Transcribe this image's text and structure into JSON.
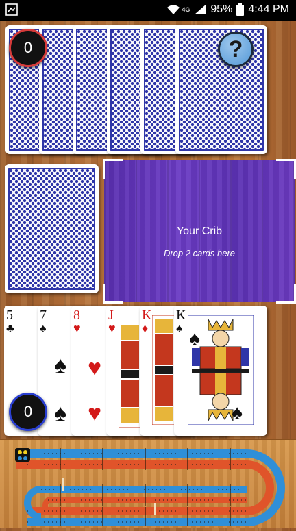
{
  "status_bar": {
    "network_label": "4G",
    "battery": "95%",
    "time": "4:44 PM"
  },
  "opponent": {
    "score": "0",
    "cards_in_hand": 6,
    "badge_color": "#d63a3a"
  },
  "help": {
    "label": "?"
  },
  "deck": {
    "label": "deck"
  },
  "crib": {
    "title": "Your Crib",
    "instruction": "Drop 2 cards here",
    "color": "#6234b8"
  },
  "player": {
    "score": "0",
    "badge_color": "#2a3fd1",
    "hand": [
      {
        "rank": "5",
        "suit": "♣",
        "color": "black"
      },
      {
        "rank": "7",
        "suit": "♠",
        "color": "black"
      },
      {
        "rank": "8",
        "suit": "♥",
        "color": "red"
      },
      {
        "rank": "J",
        "suit": "♥",
        "color": "red"
      },
      {
        "rank": "K",
        "suit": "♦",
        "color": "red"
      },
      {
        "rank": "K",
        "suit": "♠",
        "color": "black"
      }
    ]
  },
  "cribbage_board": {
    "track_colors": [
      "#2f8fd8",
      "#e0542a"
    ],
    "peg_colors": [
      "#f2d020",
      "#2f8fd8"
    ]
  }
}
